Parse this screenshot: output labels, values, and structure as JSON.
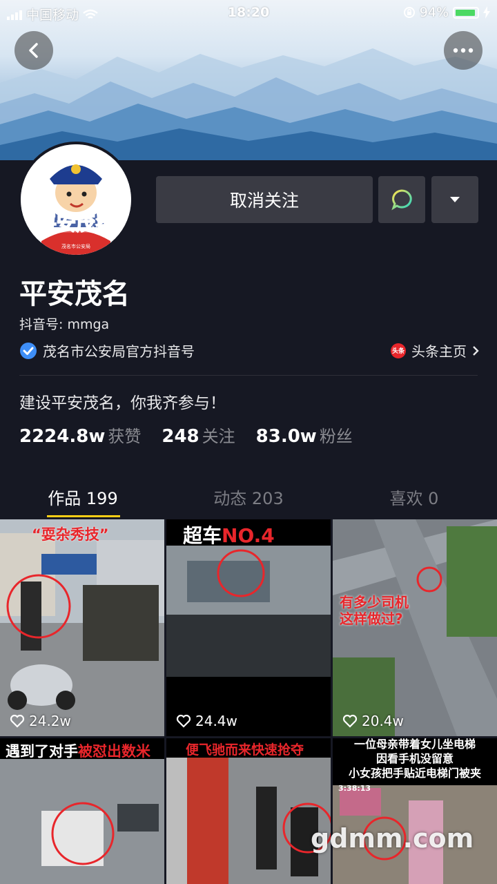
{
  "status_bar": {
    "carrier": "中国移动",
    "time": "18:20",
    "battery": "94%",
    "battery_level": 0.94
  },
  "profile": {
    "name": "平安茂名",
    "douyin_id": "抖音号: mmga",
    "verification": "茂名市公安局官方抖音号",
    "toutiao_link": "头条主页",
    "toutiao_badge": "头条",
    "bio": "建设平安茂名，你我齐参与！",
    "avatar_text": "平安茂名",
    "avatar_subtext": "茂名市公安局"
  },
  "actions": {
    "unfollow_label": "取消关注"
  },
  "stats": [
    {
      "value": "2224.8w",
      "label": "获赞"
    },
    {
      "value": "248",
      "label": "关注"
    },
    {
      "value": "83.0w",
      "label": "粉丝"
    }
  ],
  "tabs": [
    {
      "label": "作品 199",
      "active": true
    },
    {
      "label": "动态 203",
      "active": false
    },
    {
      "label": "喜欢 0",
      "active": false
    }
  ],
  "videos": [
    {
      "likes": "24.2w",
      "caption": "“耍杂秀技”"
    },
    {
      "likes": "24.4w",
      "caption_white": "超车",
      "caption_red": "NO.4"
    },
    {
      "likes": "20.4w",
      "caption_line1": "有多少司机",
      "caption_line2": "这样做过?"
    },
    {
      "caption_white": "遇到了对手",
      "caption_red": "被怼出数米"
    },
    {
      "caption": "便飞驰而来快速抢夺"
    },
    {
      "caption_line1": "一位母亲带着女儿坐电梯",
      "caption_line2": "因看手机没留意",
      "caption_line3": "小女孩把手贴近电梯门被夹",
      "timestamp": "3:38:13"
    }
  ],
  "watermark": "gdmm.com",
  "colors": {
    "background": "#161823",
    "tab_indicator": "#face15",
    "button_bg": "#3a3b44",
    "verify_blue": "#3e8ef7",
    "caption_red": "#e8262b"
  }
}
